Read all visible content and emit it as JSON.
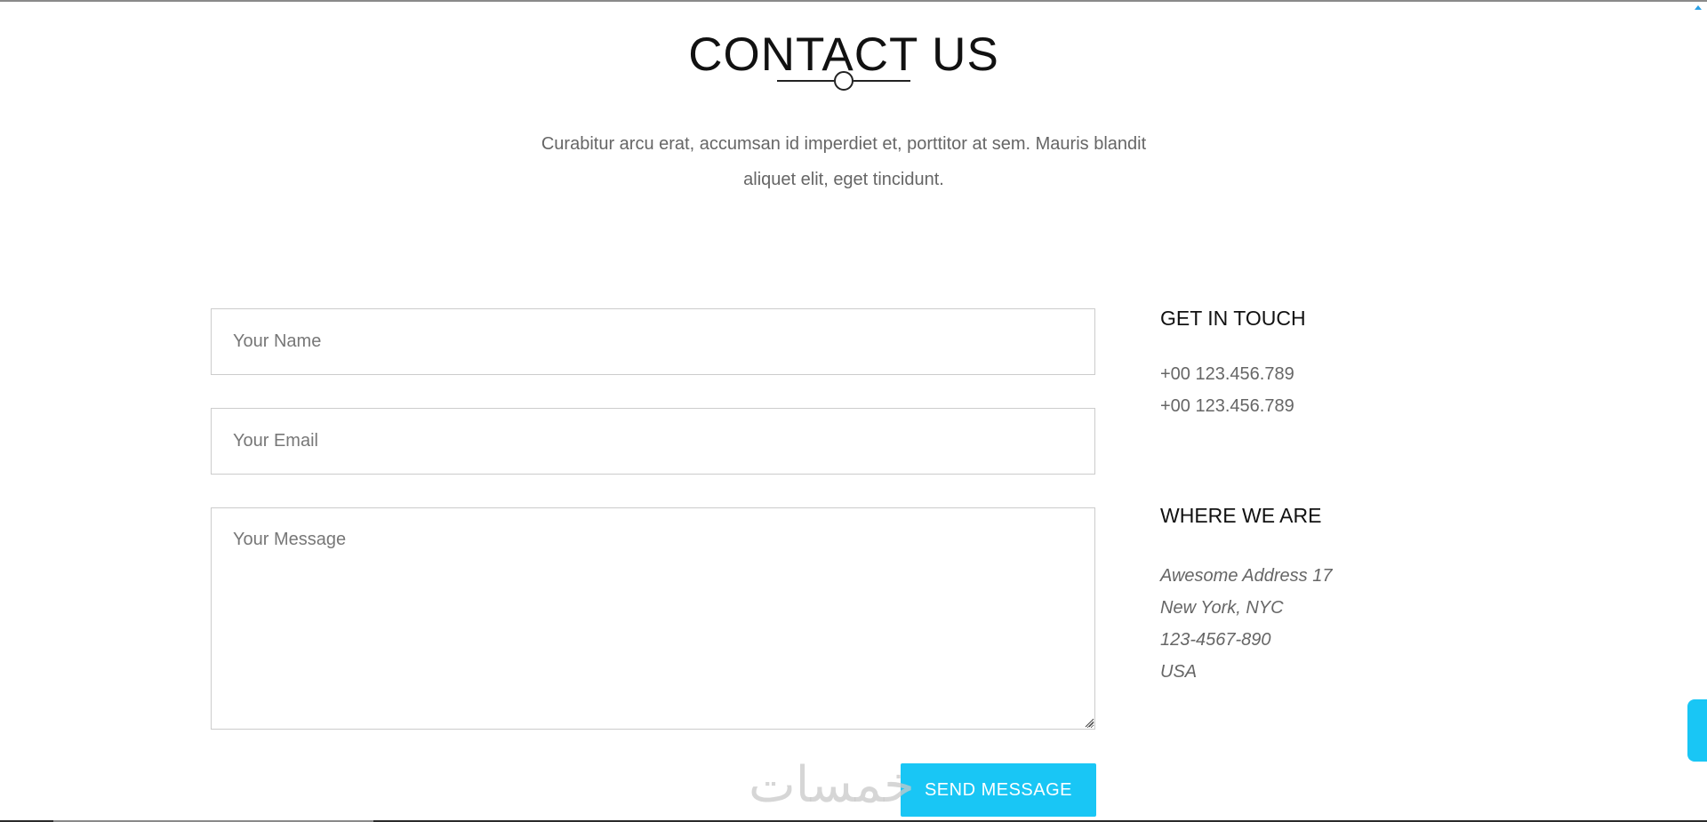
{
  "contact": {
    "title": "CONTACT US",
    "description": "Curabitur arcu erat, accumsan id imperdiet et, porttitor at sem. Mauris blandit aliquet elit, eget tincidunt."
  },
  "form": {
    "name_placeholder": "Your Name",
    "email_placeholder": "Your Email",
    "message_placeholder": "Your Message",
    "submit_label": "SEND MESSAGE"
  },
  "get_in_touch": {
    "heading": "GET IN TOUCH",
    "phones": [
      "+00 123.456.789",
      "+00 123.456.789"
    ]
  },
  "where_we_are": {
    "heading": "WHERE WE ARE",
    "address": [
      "Awesome Address 17",
      "New York, NYC",
      "123-4567-890",
      "USA"
    ]
  },
  "watermark": {
    "text": "خمسات"
  },
  "colors": {
    "accent": "#19c6f5",
    "text_dark": "#111111",
    "text_muted": "#666666",
    "field_border": "#cccccc"
  },
  "icons": {
    "divider": "line-circle-divider-icon",
    "scroll_up": "scroll-up-arrow-icon",
    "resize": "resize-grip-icon"
  }
}
